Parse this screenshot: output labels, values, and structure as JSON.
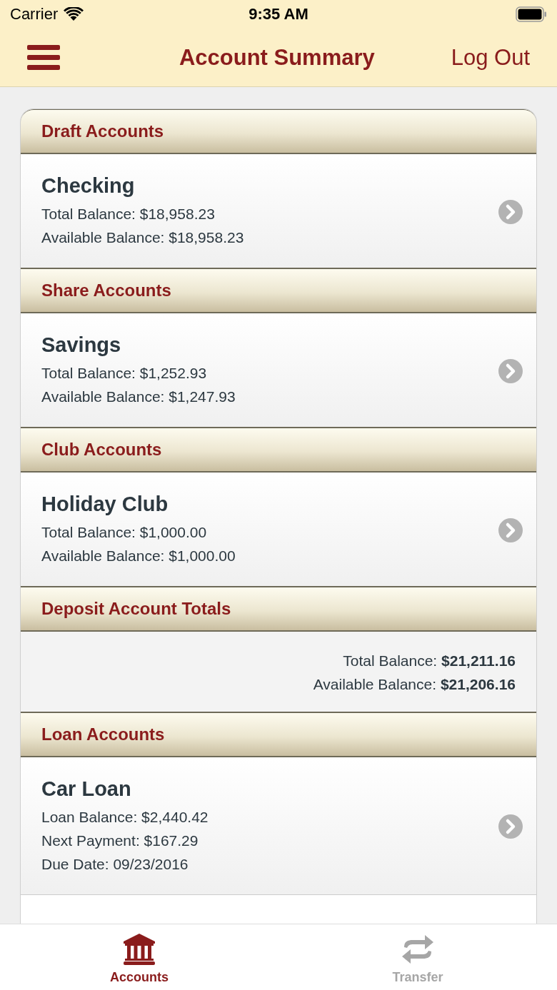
{
  "status_bar": {
    "carrier": "Carrier",
    "time": "9:35 AM"
  },
  "nav_bar": {
    "title": "Account Summary",
    "action": "Log Out"
  },
  "sections": [
    {
      "kind": "accounts",
      "title": "Draft Accounts",
      "accounts": [
        {
          "name": "Checking",
          "lines": [
            "Total Balance: $18,958.23",
            "Available Balance: $18,958.23"
          ]
        }
      ]
    },
    {
      "kind": "accounts",
      "title": "Share Accounts",
      "accounts": [
        {
          "name": "Savings",
          "lines": [
            "Total Balance: $1,252.93",
            "Available Balance: $1,247.93"
          ]
        }
      ]
    },
    {
      "kind": "accounts",
      "title": "Club Accounts",
      "accounts": [
        {
          "name": "Holiday Club",
          "lines": [
            "Total Balance: $1,000.00",
            "Available Balance: $1,000.00"
          ]
        }
      ]
    },
    {
      "kind": "totals",
      "title": "Deposit Account Totals",
      "lines": [
        "Total Balance: **$21,211.16**",
        "Available Balance: **$21,206.16**"
      ]
    },
    {
      "kind": "accounts",
      "title": "Loan Accounts",
      "accounts": [
        {
          "name": "Car Loan",
          "lines": [
            "Loan Balance: $2,440.42",
            "Next Payment: $167.29",
            "Due Date: 09/23/2016"
          ]
        }
      ]
    }
  ],
  "tab_bar": [
    {
      "kind": "bank",
      "label": "Accounts",
      "selected": true
    },
    {
      "kind": "transfer",
      "label": "Transfer",
      "selected": false
    }
  ]
}
